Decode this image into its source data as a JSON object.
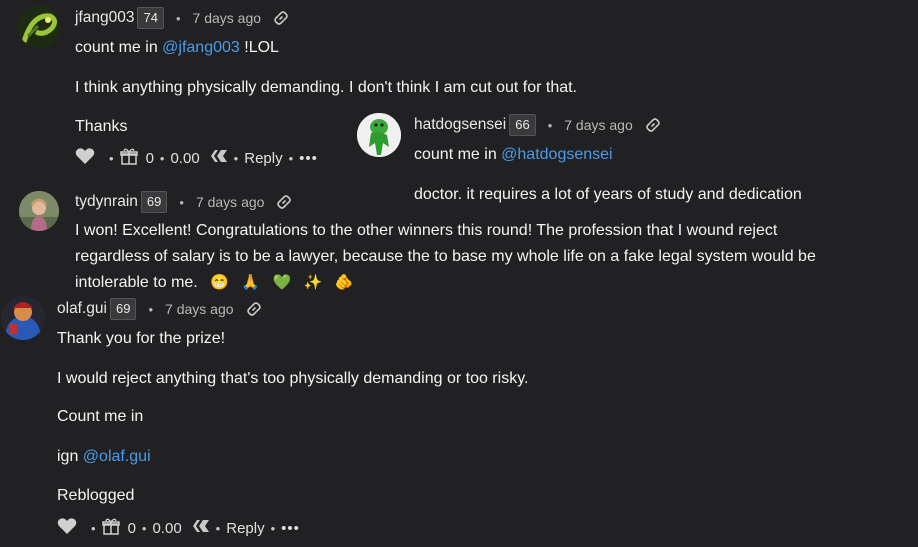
{
  "comments": [
    {
      "username": "jfang003",
      "reputation": "74",
      "time": "7 days ago",
      "mention_prefix": "count me in ",
      "mention": "@jfang003",
      "mention_suffix": " !LOL",
      "paragraph2": "I think anything physically demanding. I don't think I am cut out for that.",
      "paragraph3": "Thanks",
      "votes": "0",
      "payout": "0.00",
      "reply": "Reply"
    },
    {
      "username": "hatdogsensei",
      "reputation": "66",
      "time": "7 days ago",
      "mention_prefix": "count me in ",
      "mention": "@hatdogsensei",
      "paragraph2": "doctor. it requires a lot of years of study and dedication"
    },
    {
      "username": "tydynrain",
      "reputation": "69",
      "time": "7 days ago",
      "line1": "I won! Excellent! Congratulations to the other winners this round! The profession that I wound reject",
      "line2": "regardless of salary is to be a lawyer, because the to base my whole life on a fake legal system would be",
      "line3": "intolerable to me.",
      "emojis": [
        "😁",
        "🙏",
        "💚",
        "✨",
        "🫵"
      ]
    },
    {
      "username": "olaf.gui",
      "reputation": "69",
      "time": "7 days ago",
      "paragraph1": "Thank you for the prize!",
      "paragraph2": "I would reject anything that's too physically demanding or too risky.",
      "paragraph3": "Count me in",
      "ign_prefix": "ign ",
      "mention": "@olaf.gui",
      "paragraph5": "Reblogged",
      "votes": "0",
      "payout": "0.00",
      "reply": "Reply"
    }
  ],
  "separator": "•",
  "more": "•••",
  "colors": {
    "background": "#212123",
    "mention": "#4a9be8",
    "text": "#f4f4f4",
    "muted": "#b8b8b8"
  }
}
